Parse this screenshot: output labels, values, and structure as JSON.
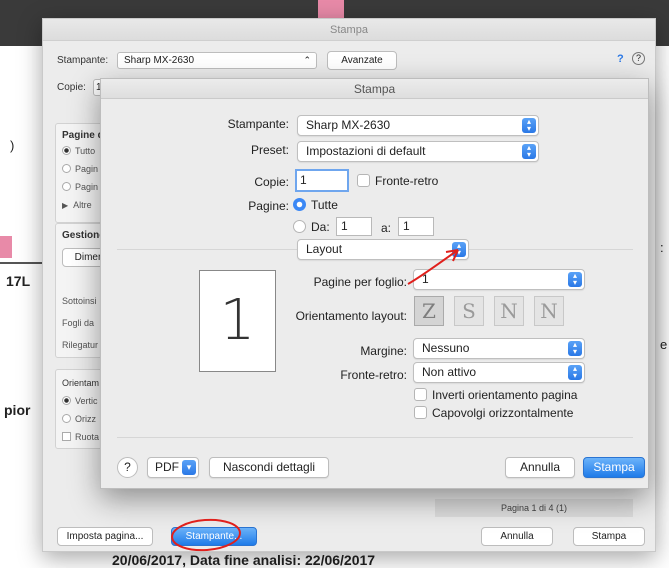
{
  "background_doc": {
    "fragment_1": "17L",
    "fragment_2": "pior",
    "fragment_3": ")",
    "fragment_4": "e",
    "fragment_5": ":",
    "footer_text": "20/06/2017, Data fine analisi: 22/06/2017"
  },
  "outer_dialog": {
    "title": "Stampa",
    "printer_label": "Stampante:",
    "printer_value": "Sharp MX-2630",
    "advanced_button": "Avanzate",
    "info_q": "?",
    "copies_label": "Copie:",
    "copies_value": "1",
    "pages_group_title": "Pagine d",
    "pages_items": [
      "Tutto",
      "Pagin",
      "Pagin",
      "Altre"
    ],
    "manage_group_title": "Gestione",
    "size_button": "Dimer",
    "misc_items": [
      "Sottoinsi",
      "Fogli da",
      "Rilegatur"
    ],
    "orient_title": "Orientam",
    "orient_items": [
      "Vertic",
      "Orizz",
      "Ruota"
    ],
    "page_counter": "Pagina 1 di 4 (1)",
    "page_setup_button": "Imposta pagina...",
    "print_dots_button": "Stampante...",
    "cancel_button": "Annulla",
    "print_button": "Stampa"
  },
  "inner_dialog": {
    "title": "Stampa",
    "printer_label": "Stampante:",
    "printer_value": "Sharp MX-2630",
    "preset_label": "Preset:",
    "preset_value": "Impostazioni di default",
    "copies_label": "Copie:",
    "copies_value": "1",
    "duplex_label": "Fronte-retro",
    "pages_label": "Pagine:",
    "pages_all_label": "Tutte",
    "pages_from_label": "Da:",
    "pages_from_value": "1",
    "pages_to_label": "a:",
    "pages_to_value": "1",
    "section_value": "Layout",
    "preview_page_number": "1",
    "pages_per_sheet_label": "Pagine per foglio:",
    "pages_per_sheet_value": "1",
    "layout_direction_label": "Orientamento layout:",
    "layout_direction_options": [
      "Z",
      "S",
      "N",
      "N"
    ],
    "border_label": "Margine:",
    "border_value": "Nessuno",
    "two_sided_label": "Fronte-retro:",
    "two_sided_value": "Non attivo",
    "reverse_orientation_label": "Inverti orientamento pagina",
    "flip_horizontal_label": "Capovolgi orizzontalmente",
    "help_label": "?",
    "pdf_label": "PDF",
    "hide_details_button": "Nascondi dettagli",
    "cancel_button": "Annulla",
    "print_button": "Stampa"
  },
  "colors": {
    "accent": "#2a78e6",
    "annotation_red": "#e0201c"
  },
  "icons": {
    "popup_arrows": "chevron-up-down-icon",
    "pdf_dropdown": "chevron-down-icon",
    "info": "info-icon",
    "help": "help-icon"
  }
}
